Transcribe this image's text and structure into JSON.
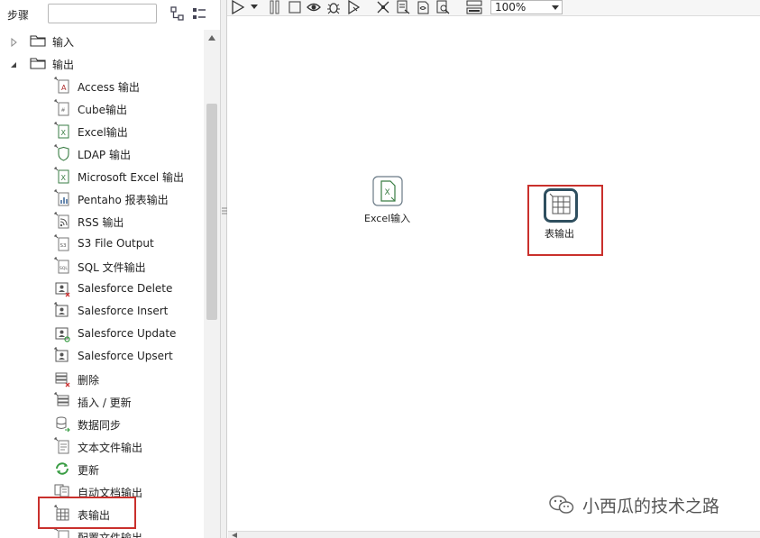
{
  "left_panel": {
    "title": "步骤",
    "search": {
      "value": "",
      "placeholder": ""
    },
    "tree": {
      "folders": [
        {
          "label": "输入",
          "expanded": false
        },
        {
          "label": "输出",
          "expanded": true
        }
      ],
      "output_steps": [
        {
          "label": "Access 输出",
          "icon": "access-output-icon"
        },
        {
          "label": "Cube输出",
          "icon": "cube-output-icon"
        },
        {
          "label": "Excel输出",
          "icon": "excel-output-icon"
        },
        {
          "label": "LDAP 输出",
          "icon": "ldap-output-icon"
        },
        {
          "label": "Microsoft Excel 输出",
          "icon": "ms-excel-output-icon"
        },
        {
          "label": "Pentaho 报表输出",
          "icon": "pentaho-report-icon"
        },
        {
          "label": "RSS 输出",
          "icon": "rss-output-icon"
        },
        {
          "label": "S3 File Output",
          "icon": "s3-output-icon"
        },
        {
          "label": "SQL 文件输出",
          "icon": "sql-file-output-icon"
        },
        {
          "label": "Salesforce Delete",
          "icon": "salesforce-delete-icon"
        },
        {
          "label": "Salesforce Insert",
          "icon": "salesforce-insert-icon"
        },
        {
          "label": "Salesforce Update",
          "icon": "salesforce-update-icon"
        },
        {
          "label": "Salesforce Upsert",
          "icon": "salesforce-upsert-icon"
        },
        {
          "label": "删除",
          "icon": "delete-icon"
        },
        {
          "label": "插入 / 更新",
          "icon": "insert-update-icon"
        },
        {
          "label": "数据同步",
          "icon": "data-sync-icon"
        },
        {
          "label": "文本文件输出",
          "icon": "text-file-output-icon"
        },
        {
          "label": "更新",
          "icon": "update-icon"
        },
        {
          "label": "自动文档输出",
          "icon": "auto-doc-output-icon"
        },
        {
          "label": "表输出",
          "icon": "table-output-icon",
          "highlighted": true
        },
        {
          "label": "配置文件输出",
          "icon": "properties-output-icon"
        }
      ]
    }
  },
  "toolbar": {
    "zoom": "100%"
  },
  "canvas": {
    "nodes": [
      {
        "label": "Excel输入",
        "icon": "excel-input-icon"
      },
      {
        "label": "表输出",
        "icon": "table-output-icon",
        "highlighted": true
      }
    ]
  },
  "watermark": "小西瓜的技术之路",
  "colors": {
    "highlight": "#c9302c",
    "excel_green": "#3a7d44",
    "node_border": "#2f4f5f"
  }
}
